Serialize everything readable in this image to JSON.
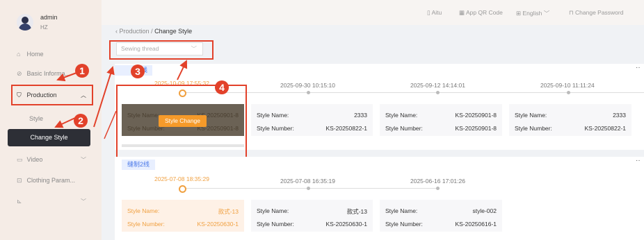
{
  "user": {
    "name": "admin",
    "sub": "HZ"
  },
  "nav": {
    "home": "Home",
    "basic": "Basic Informa...",
    "production": "Production",
    "style": "Style",
    "change_style": "Change Style",
    "video": "Video",
    "clothing": "Clothing Param..."
  },
  "topbar": {
    "aitu": "Aitu",
    "qr": "App QR Code",
    "lang": "English",
    "pwd": "Change Password"
  },
  "breadcrumb": {
    "parent": "Production",
    "sep": "/",
    "current": "Change Style"
  },
  "filter": {
    "placeholder": "Sewing thread"
  },
  "badges": [
    "1",
    "2",
    "3",
    "4"
  ],
  "line1": {
    "tag": "线",
    "timestamps": [
      "2025-10-09 17:55:32",
      "2025-09-30 10:15:10",
      "2025-09-12 14:14:01",
      "2025-09-10 11:11:24"
    ],
    "cards": [
      {
        "name_label": "Style Name:",
        "name": "KS-20250901-8",
        "num_label": "Style Number:",
        "num": "KS-20250901-8"
      },
      {
        "name_label": "Style Name:",
        "name": "2333",
        "num_label": "Style Number:",
        "num": "KS-20250822-1"
      },
      {
        "name_label": "Style Name:",
        "name": "KS-20250901-8",
        "num_label": "Style Number:",
        "num": "KS-20250901-8"
      },
      {
        "name_label": "Style Name:",
        "name": "2333",
        "num_label": "Style Number:",
        "num": "KS-20250822-1"
      }
    ],
    "overlay_button": "Style Change"
  },
  "line2": {
    "tag": "缝制2线",
    "timestamps": [
      "2025-07-08 18:35:29",
      "2025-07-08 16:35:19",
      "2025-06-16 17:01:26"
    ],
    "cards": [
      {
        "name_label": "Style Name:",
        "name": "款式-13",
        "num_label": "Style Number:",
        "num": "KS-20250630-1"
      },
      {
        "name_label": "Style Name:",
        "name": "款式-13",
        "num_label": "Style Number:",
        "num": "KS-20250630-1"
      },
      {
        "name_label": "Style Name:",
        "name": "style-002",
        "num_label": "Style Number:",
        "num": "KS-20250616-1"
      }
    ]
  },
  "colors": {
    "accent": "#f0a040",
    "annotation": "#e2412a",
    "tag": "#4a78e8"
  }
}
